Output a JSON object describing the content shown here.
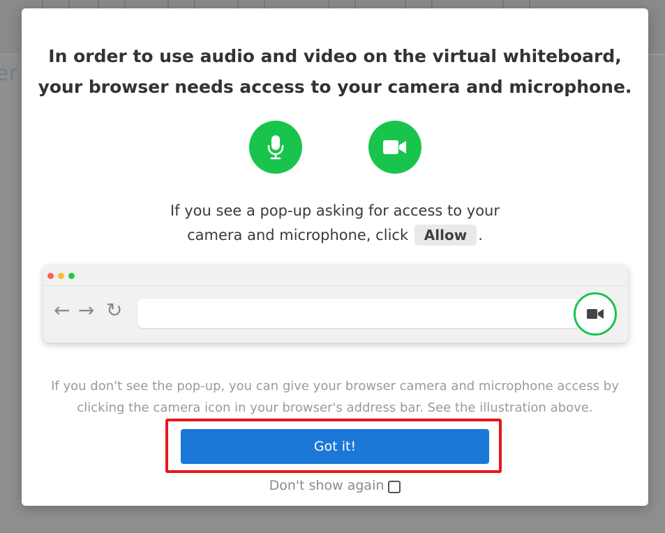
{
  "background": {
    "partial_text": "er"
  },
  "modal": {
    "title_line1": "In order to use audio and video on the virtual whiteboard,",
    "title_line2": "your browser needs access to your camera and microphone.",
    "icons": {
      "microphone": "microphone-icon",
      "camera": "video-camera-icon"
    },
    "instruction_line1": "If you see a pop-up asking for access to your",
    "instruction_line2_pre": "camera and microphone, click",
    "allow_label": "Allow",
    "instruction_line2_post": ".",
    "browser_illustration": {
      "back_glyph": "←",
      "forward_glyph": "→",
      "reload_glyph": "↻"
    },
    "help_line1": "If you don't see the pop-up, you can give your browser camera and microphone access by",
    "help_line2": "clicking the camera icon in your browser's address bar. See the illustration above.",
    "got_it_label": "Got it!",
    "dont_show_label": "Don't show again",
    "dont_show_checked": false
  },
  "colors": {
    "accent_green": "#19c44d",
    "button_blue": "#1b78d7",
    "highlight_red": "#e6181b"
  }
}
